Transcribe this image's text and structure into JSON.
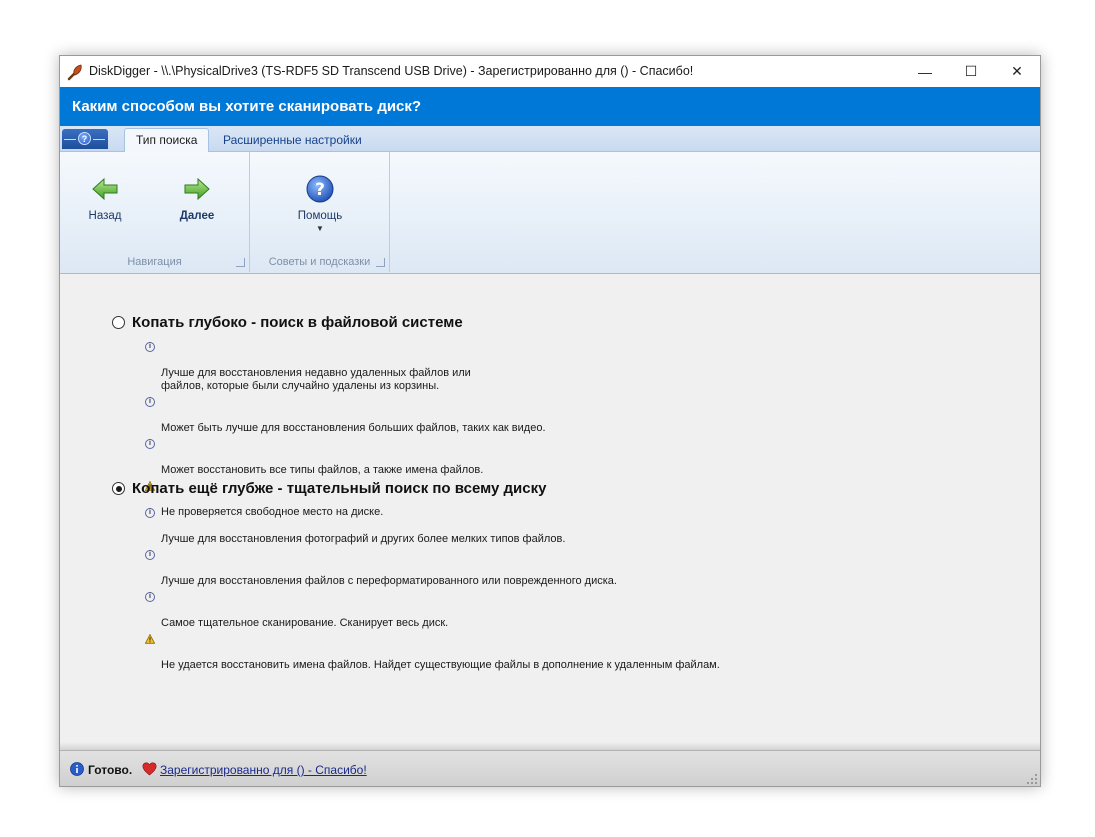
{
  "window": {
    "title": "DiskDigger - \\\\.\\PhysicalDrive3 (TS-RDF5 SD  Transcend USB Drive) - Зарегистрированно для  () - Спасибо!",
    "controls": {
      "minimize": "—",
      "maximize": "☐",
      "close": "✕"
    }
  },
  "header": {
    "title": "Каким способом вы хотите сканировать диск?"
  },
  "ribbon": {
    "tabs": [
      {
        "label": "Тип поиска",
        "active": true
      },
      {
        "label": "Расширенные настройки",
        "active": false
      }
    ],
    "groups": {
      "navigation": {
        "label": "Навигация",
        "back_label": "Назад",
        "next_label": "Далее"
      },
      "tips": {
        "label": "Советы и подсказки",
        "help_label": "Помощь"
      }
    }
  },
  "options": {
    "deep": {
      "title": "Копать глубоко - поиск в файловой системе",
      "selected": false,
      "bullets": [
        {
          "type": "info",
          "text": "Лучше для восстановления недавно удаленных файлов или\nфайлов, которые были случайно удалены из корзины."
        },
        {
          "type": "info",
          "text": "Может быть лучше для восстановления больших файлов, таких как видео."
        },
        {
          "type": "info",
          "text": "Может восстановить все типы файлов, а также имена файлов."
        },
        {
          "type": "warning",
          "text": "Не проверяется свободное место на диске."
        }
      ]
    },
    "deeper": {
      "title": "Копать ещё глубже - тщательный поиск по всему диску",
      "selected": true,
      "bullets": [
        {
          "type": "info",
          "text": "Лучше для восстановления фотографий и других более мелких типов файлов."
        },
        {
          "type": "info",
          "text": "Лучше для восстановления файлов с переформатированного или поврежденного диска."
        },
        {
          "type": "info",
          "text": "Самое тщательное сканирование. Сканирует весь диск."
        },
        {
          "type": "warning",
          "text": "Не удается восстановить имена файлов. Найдет существующие файлы в дополнение к удаленным файлам."
        }
      ]
    }
  },
  "status": {
    "ready": "Готово.",
    "link": "Зарегистрированно для  () - Спасибо!"
  },
  "colors": {
    "header_bg": "#0078d7",
    "ribbon_text": "#1e3a66",
    "arrow_green": "#4caf3c",
    "heart_red": "#d62b2b"
  }
}
